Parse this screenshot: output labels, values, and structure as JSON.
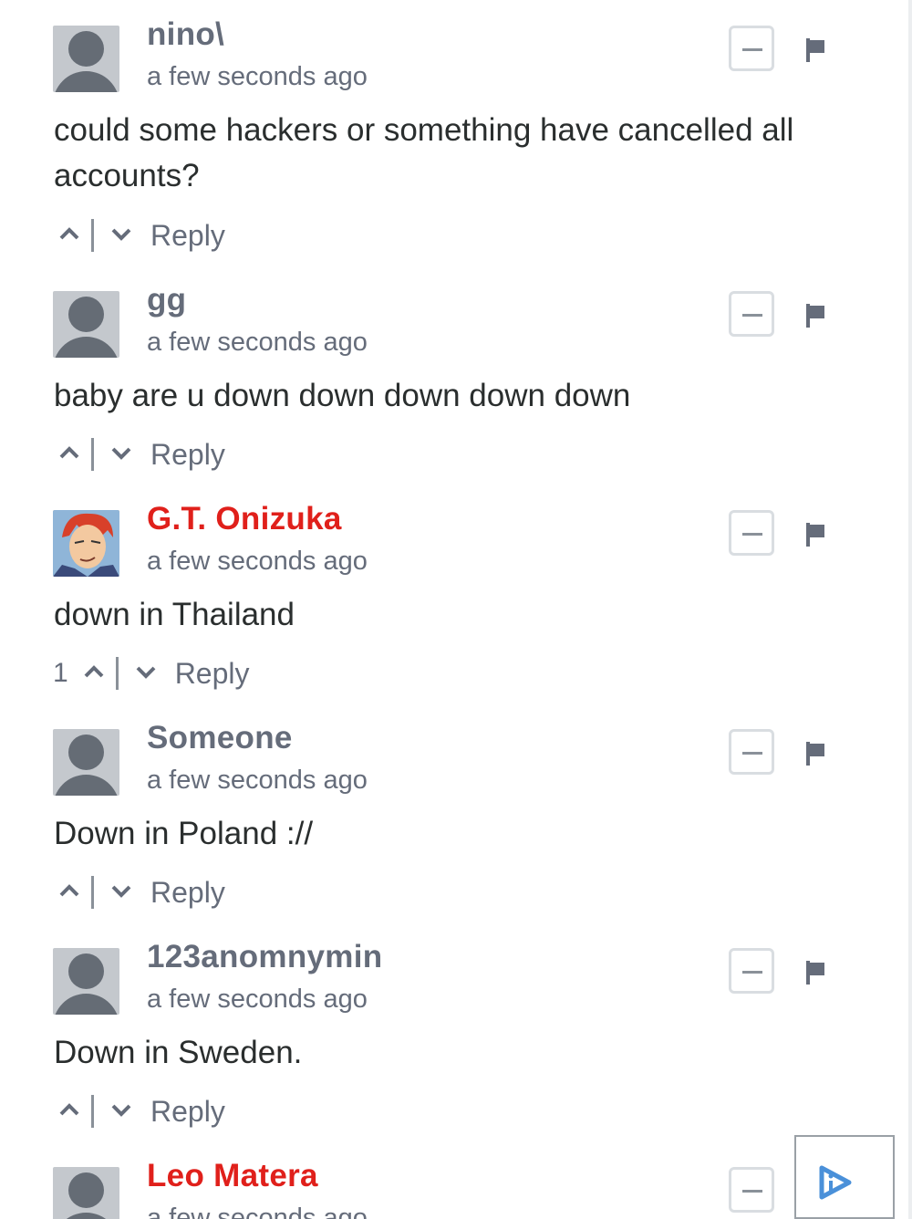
{
  "comments": [
    {
      "author": "nino\\",
      "author_color": "#656c7a",
      "timestamp": "a few seconds ago",
      "text": "could some hackers or something have cancelled all accounts?",
      "score": "",
      "reply_label": "Reply",
      "avatar": "default-avatar"
    },
    {
      "author": "gg",
      "author_color": "#656c7a",
      "timestamp": "a few seconds ago",
      "text": "baby are u down down down down down",
      "score": "",
      "reply_label": "Reply",
      "avatar": "default-avatar"
    },
    {
      "author": "G.T. Onizuka",
      "author_color": "#e0201b",
      "timestamp": "a few seconds ago",
      "text": "down in Thailand",
      "score": "1",
      "reply_label": "Reply",
      "avatar": "anime-character-avatar"
    },
    {
      "author": "Someone",
      "author_color": "#656c7a",
      "timestamp": "a few seconds ago",
      "text": "Down in Poland ://",
      "score": "",
      "reply_label": "Reply",
      "avatar": "default-avatar"
    },
    {
      "author": "123anomnymin",
      "author_color": "#656c7a",
      "timestamp": "a few seconds ago",
      "text": "Down in Sweden.",
      "score": "",
      "reply_label": "Reply",
      "avatar": "default-avatar"
    },
    {
      "author": "Leo Matera",
      "author_color": "#e0201b",
      "timestamp": "a few seconds ago",
      "text": "",
      "score": "",
      "reply_label": "",
      "avatar": "default-avatar"
    }
  ],
  "icons": {
    "upvote": "chevron-up-icon",
    "downvote": "chevron-down-icon",
    "collapse": "minus-icon",
    "flag": "flag-icon",
    "ad_choices": "adchoices-icon"
  }
}
